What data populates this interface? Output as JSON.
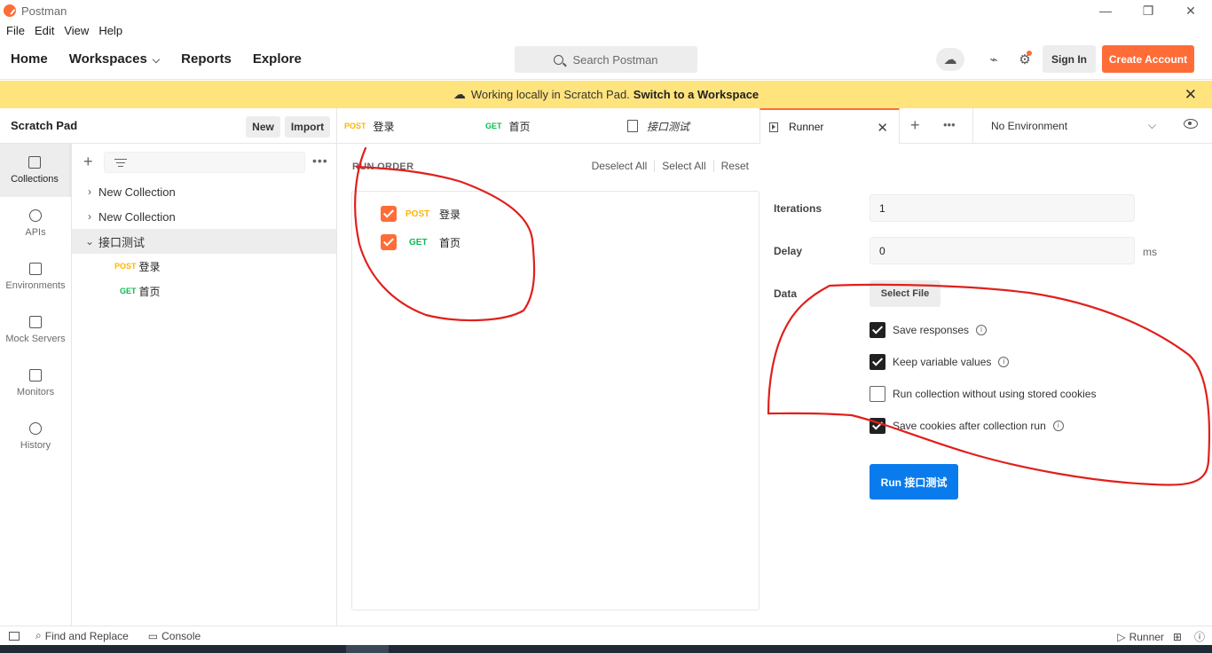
{
  "window": {
    "app_name": "Postman",
    "min": "—",
    "restore": "❐",
    "close": "✕"
  },
  "menu": [
    "File",
    "Edit",
    "View",
    "Help"
  ],
  "header": {
    "nav": [
      "Home",
      "Workspaces",
      "Reports",
      "Explore"
    ],
    "search_placeholder": "Search Postman",
    "sign_in": "Sign In",
    "create_account": "Create Account"
  },
  "banner": {
    "text": "Working locally in Scratch Pad.",
    "link": "Switch to a Workspace"
  },
  "sidebar": {
    "title": "Scratch Pad",
    "new_label": "New",
    "import_label": "Import",
    "rail": [
      "Collections",
      "APIs",
      "Environments",
      "Mock Servers",
      "Monitors",
      "History"
    ],
    "tree": {
      "collections": [
        "New Collection",
        "New Collection",
        "接口测试"
      ],
      "requests": [
        {
          "method": "POST",
          "name": "登录"
        },
        {
          "method": "GET",
          "name": "首页"
        }
      ]
    }
  },
  "tabs": {
    "items": [
      {
        "method": "POST",
        "name": "登录"
      },
      {
        "method": "GET",
        "name": "首页"
      },
      {
        "name": "接口测试"
      }
    ],
    "active": "Runner",
    "environment": "No Environment"
  },
  "run_order": {
    "title": "RUN ORDER",
    "actions": [
      "Deselect All",
      "Select All",
      "Reset"
    ],
    "items": [
      {
        "method": "POST",
        "name": "登录"
      },
      {
        "method": "GET",
        "name": "首页"
      }
    ]
  },
  "config": {
    "iterations_label": "Iterations",
    "iterations_value": "1",
    "delay_label": "Delay",
    "delay_value": "0",
    "delay_unit": "ms",
    "data_label": "Data",
    "select_file": "Select File",
    "options": [
      {
        "label": "Save responses",
        "checked": true,
        "info": true
      },
      {
        "label": "Keep variable values",
        "checked": true,
        "info": true
      },
      {
        "label": "Run collection without using stored cookies",
        "checked": false,
        "info": false
      },
      {
        "label": "Save cookies after collection run",
        "checked": true,
        "info": true
      }
    ],
    "run_button": "Run 接口测试"
  },
  "status_bar": {
    "find_replace": "Find and Replace",
    "console": "Console",
    "runner": "Runner"
  },
  "colors": {
    "accent": "#ff6c37",
    "run_blue": "#097bed",
    "banner": "#ffe47e",
    "annotation_red": "#e0201c"
  }
}
